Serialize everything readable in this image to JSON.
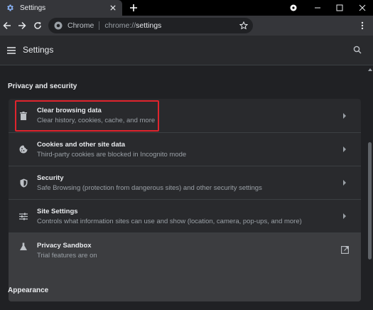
{
  "tab": {
    "title": "Settings"
  },
  "omnibox": {
    "site_label": "Chrome",
    "url_scheme": "chrome://",
    "url_path": "settings"
  },
  "header": {
    "title": "Settings"
  },
  "sections": {
    "privacy_title": "Privacy and security",
    "appearance_title": "Appearance"
  },
  "privacy_items": [
    {
      "title": "Clear browsing data",
      "subtitle": "Clear history, cookies, cache, and more",
      "icon": "trash-icon"
    },
    {
      "title": "Cookies and other site data",
      "subtitle": "Third-party cookies are blocked in Incognito mode",
      "icon": "cookie-icon"
    },
    {
      "title": "Security",
      "subtitle": "Safe Browsing (protection from dangerous sites) and other security settings",
      "icon": "shield-icon"
    },
    {
      "title": "Site Settings",
      "subtitle": "Controls what information sites can use and show (location, camera, pop-ups, and more)",
      "icon": "sliders-icon"
    },
    {
      "title": "Privacy Sandbox",
      "subtitle": "Trial features are on",
      "icon": "flask-icon"
    }
  ],
  "colors": {
    "highlight": "#e0242d",
    "accent": "#8ab4f8",
    "background": "#202124"
  }
}
